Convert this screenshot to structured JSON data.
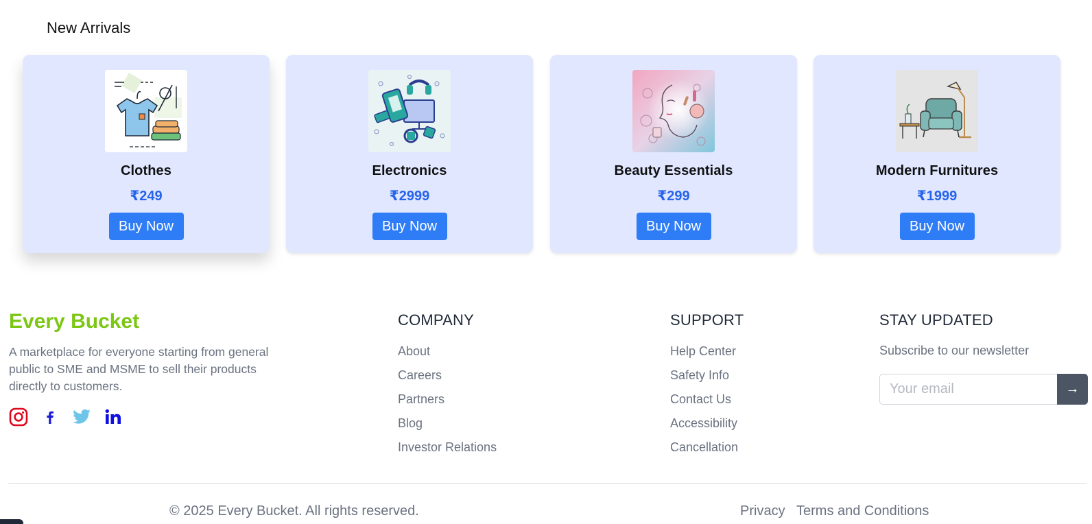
{
  "section": {
    "title": "New Arrivals"
  },
  "products": [
    {
      "name": "Clothes",
      "price": "₹249",
      "button": "Buy Now",
      "image_icon": "clothes-illustration-icon"
    },
    {
      "name": "Electronics",
      "price": "₹2999",
      "button": "Buy Now",
      "image_icon": "electronics-illustration-icon"
    },
    {
      "name": "Beauty Essentials",
      "price": "₹299",
      "button": "Buy Now",
      "image_icon": "beauty-illustration-icon"
    },
    {
      "name": "Modern Furnitures",
      "price": "₹1999",
      "button": "Buy Now",
      "image_icon": "furniture-illustration-icon"
    }
  ],
  "footer": {
    "brand": "Every Bucket",
    "description": "A marketplace for everyone starting from general public to SME and MSME to sell their products directly to customers.",
    "socials": [
      "instagram-icon",
      "facebook-icon",
      "twitter-icon",
      "linkedin-icon"
    ],
    "company": {
      "heading": "COMPANY",
      "links": [
        "About",
        "Careers",
        "Partners",
        "Blog",
        "Investor Relations"
      ]
    },
    "support": {
      "heading": "SUPPORT",
      "links": [
        "Help Center",
        "Safety Info",
        "Contact Us",
        "Accessibility",
        "Cancellation"
      ]
    },
    "newsletter": {
      "heading": "STAY UPDATED",
      "text": "Subscribe to our newsletter",
      "placeholder": "Your email",
      "submit": "→"
    },
    "copyright": "© 2025 Every Bucket. All rights reserved.",
    "privacy": "Privacy",
    "terms": "Terms and Conditions"
  },
  "colors": {
    "brand": "#7cc614",
    "card_bg": "#e0e7ff",
    "price": "#2563eb",
    "button": "#2e7cf6",
    "instagram": "#e1061b",
    "facebook": "#1b1bd6",
    "twitter": "#6ec5e9",
    "linkedin": "#1010e0"
  }
}
